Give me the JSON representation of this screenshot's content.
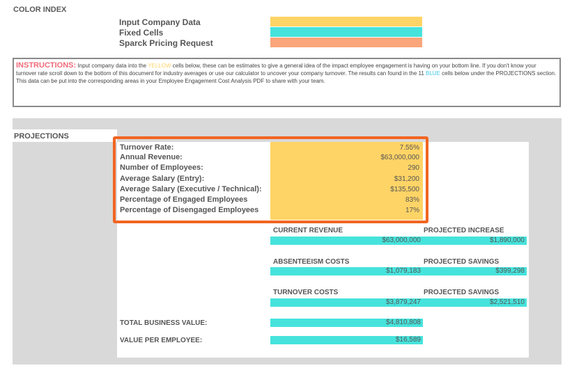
{
  "color_index": {
    "title": "COLOR INDEX",
    "items": [
      {
        "label": "Input Company Data",
        "color": "#ffd466"
      },
      {
        "label": "Fixed Cells",
        "color": "#46e3dc"
      },
      {
        "label": "Sparck Pricing Request",
        "color": "#fba57a"
      }
    ]
  },
  "instructions": {
    "heading": "INSTRUCTIONS:",
    "text_part1": " Input company data into the ",
    "yellow_word": "YELLOW",
    "text_part2": " cells below, these can be estimates to give a general idea of the impact employee engagement is having on your bottom line. If you don't know your turnover rate scroll down to the bottom of this document for industry averages or use our calculator to uncover your company turnover. The results can found in the 11 ",
    "blue_word": "BLUE",
    "text_part3": " cells below under the PROJECTIONS section.  This data can be put into the corresponding areas in your Employee Engagement Cost Analysis PDF to share with your team."
  },
  "projections": {
    "title": "PROJECTIONS",
    "inputs": [
      {
        "label": "Turnover Rate:",
        "value": "7.55%"
      },
      {
        "label": "Annual Revenue:",
        "value": "$63,000,000"
      },
      {
        "label": "Number of Employees:",
        "value": "290"
      },
      {
        "label": "Average Salary (Entry):",
        "value": "$31,200"
      },
      {
        "label": "Average Salary (Executive / Technical):",
        "value": "$135,500"
      },
      {
        "label": "Percentage of Engaged Employees",
        "value": "83%"
      },
      {
        "label": "Percentage of Disengaged Employees",
        "value": "17%"
      }
    ],
    "current_revenue": {
      "label": "CURRENT REVENUE",
      "value": "$63,000,000"
    },
    "projected_increase": {
      "label": "PROJECTED INCREASE",
      "value": "$1,890,000"
    },
    "absenteeism_costs": {
      "label": "ABSENTEEISM COSTS",
      "value": "$1,079,183"
    },
    "absenteeism_savings": {
      "label": "PROJECTED SAVINGS",
      "value": "$399,298"
    },
    "turnover_costs": {
      "label": "TURNOVER COSTS",
      "value": "$3,879,247"
    },
    "turnover_savings": {
      "label": "PROJECTED SAVINGS",
      "value": "$2,521,510"
    },
    "total_business_value": {
      "label": "TOTAL BUSINESS VALUE:",
      "value": "$4,810,808"
    },
    "value_per_employee": {
      "label": "VALUE PER EMPLOYEE:",
      "value": "$16,589"
    }
  }
}
